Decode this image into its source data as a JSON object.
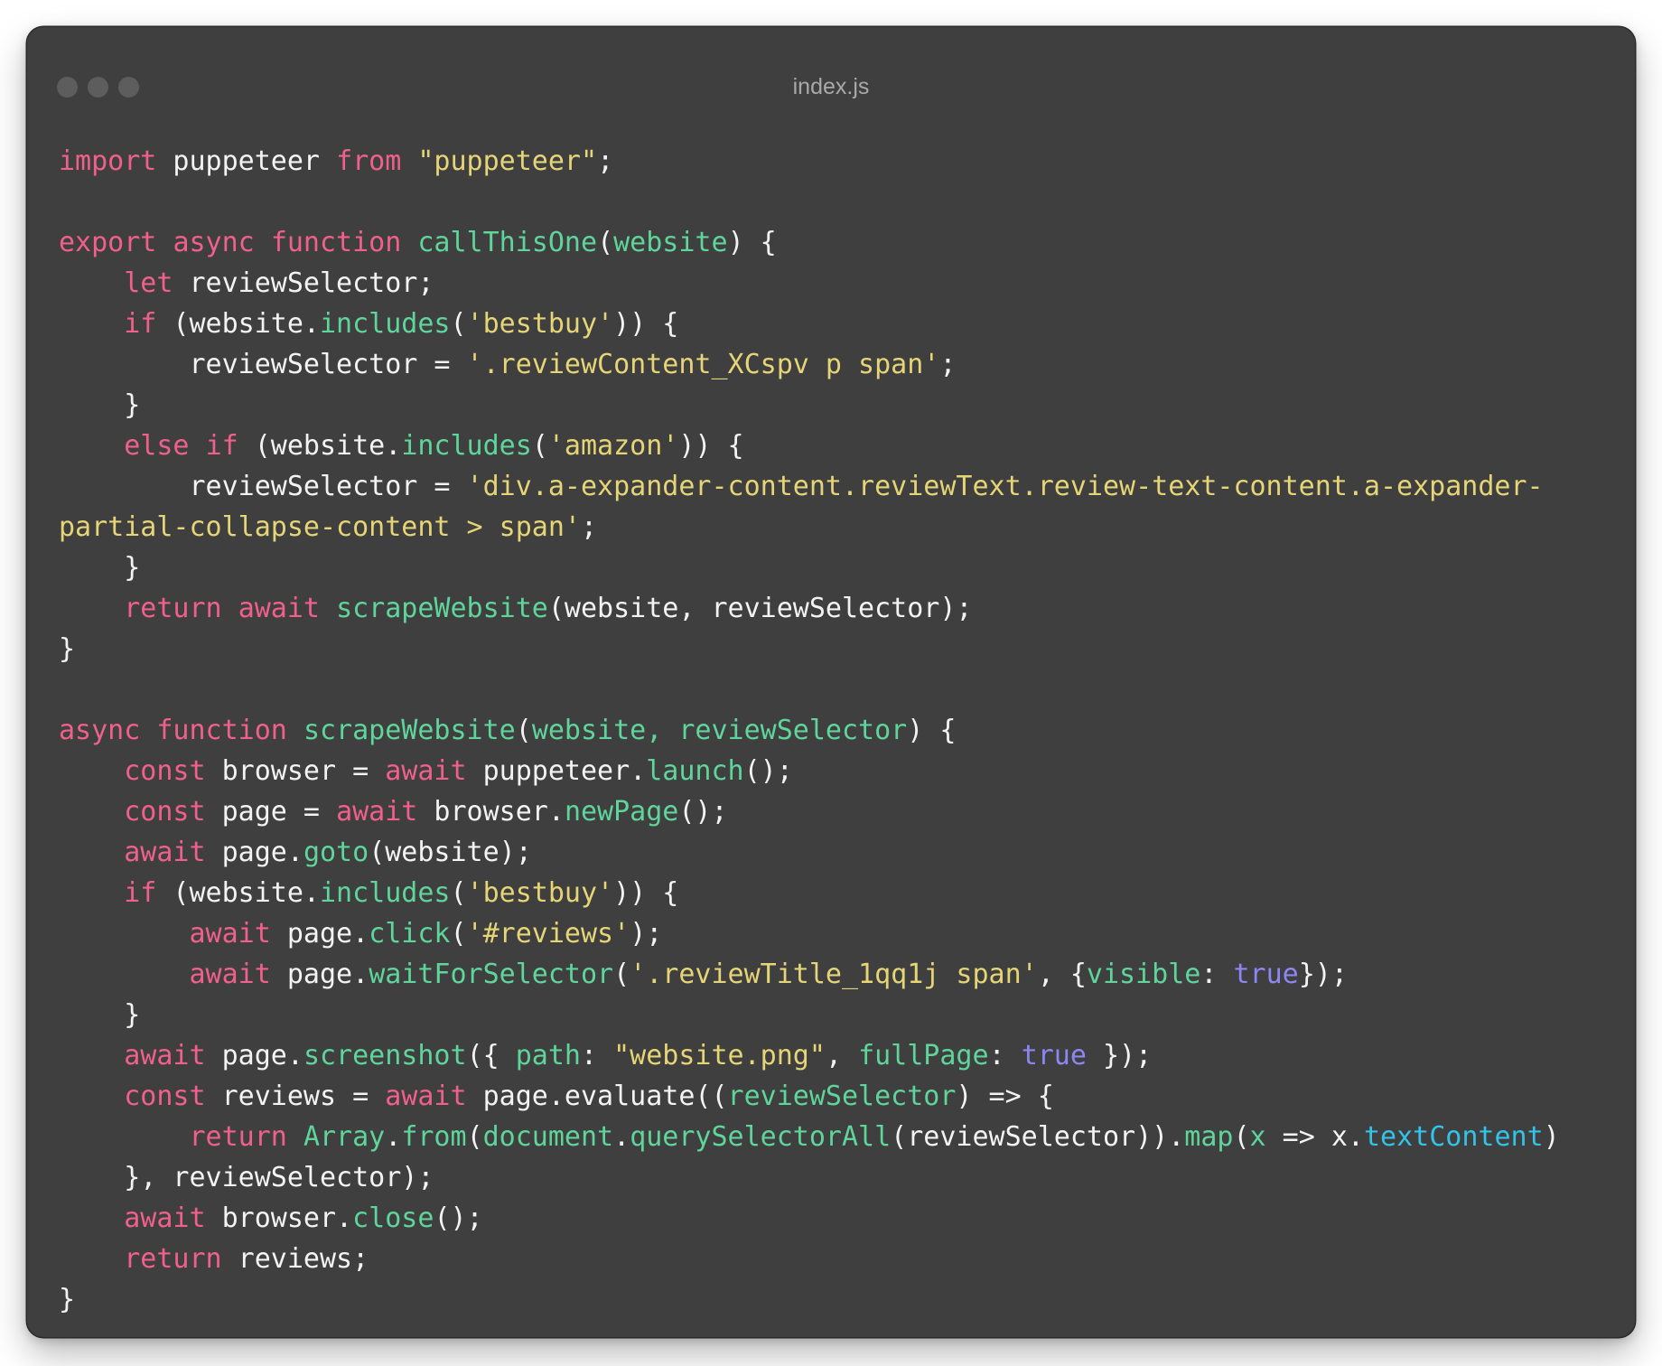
{
  "window": {
    "title": "index.js"
  },
  "colors": {
    "background": "#3f3f3f",
    "keyword": "#f0608c",
    "function": "#5fd59b",
    "string": "#e6d577",
    "boolean": "#8c87f2",
    "property": "#33c3e8",
    "text": "#f3f3f3"
  },
  "code_lines": [
    [
      [
        "kw",
        "import"
      ],
      [
        "plain",
        " puppeteer "
      ],
      [
        "kw",
        "from"
      ],
      [
        "plain",
        " "
      ],
      [
        "str",
        "\"puppeteer\""
      ],
      [
        "plain",
        ";"
      ]
    ],
    [],
    [
      [
        "kw",
        "export"
      ],
      [
        "plain",
        " "
      ],
      [
        "kw",
        "async"
      ],
      [
        "plain",
        " "
      ],
      [
        "kw",
        "function"
      ],
      [
        "plain",
        " "
      ],
      [
        "fn",
        "callThisOne"
      ],
      [
        "plain",
        "("
      ],
      [
        "pr",
        "website"
      ],
      [
        "plain",
        ") {"
      ]
    ],
    [
      [
        "plain",
        "    "
      ],
      [
        "kw",
        "let"
      ],
      [
        "plain",
        " reviewSelector;"
      ]
    ],
    [
      [
        "plain",
        "    "
      ],
      [
        "kw",
        "if"
      ],
      [
        "plain",
        " (website."
      ],
      [
        "fn",
        "includes"
      ],
      [
        "plain",
        "("
      ],
      [
        "str",
        "'bestbuy'"
      ],
      [
        "plain",
        ")) {"
      ]
    ],
    [
      [
        "plain",
        "        reviewSelector = "
      ],
      [
        "str",
        "'.reviewContent_XCspv p span'"
      ],
      [
        "plain",
        ";"
      ]
    ],
    [
      [
        "plain",
        "    }"
      ]
    ],
    [
      [
        "plain",
        "    "
      ],
      [
        "kw",
        "else"
      ],
      [
        "plain",
        " "
      ],
      [
        "kw",
        "if"
      ],
      [
        "plain",
        " (website."
      ],
      [
        "fn",
        "includes"
      ],
      [
        "plain",
        "("
      ],
      [
        "str",
        "'amazon'"
      ],
      [
        "plain",
        ")) {"
      ]
    ],
    [
      [
        "plain",
        "        reviewSelector = "
      ],
      [
        "str",
        "'div.a-expander-content.reviewText.review-text-content.a-expander-"
      ]
    ],
    [
      [
        "str",
        "partial-collapse-content > span'"
      ],
      [
        "plain",
        ";"
      ]
    ],
    [
      [
        "plain",
        "    }"
      ]
    ],
    [
      [
        "plain",
        "    "
      ],
      [
        "kw",
        "return"
      ],
      [
        "plain",
        " "
      ],
      [
        "kw",
        "await"
      ],
      [
        "plain",
        " "
      ],
      [
        "fn",
        "scrapeWebsite"
      ],
      [
        "plain",
        "(website, reviewSelector);"
      ]
    ],
    [
      [
        "plain",
        "}"
      ]
    ],
    [],
    [
      [
        "kw",
        "async"
      ],
      [
        "plain",
        " "
      ],
      [
        "kw",
        "function"
      ],
      [
        "plain",
        " "
      ],
      [
        "fn",
        "scrapeWebsite"
      ],
      [
        "plain",
        "("
      ],
      [
        "pr",
        "website, reviewSelector"
      ],
      [
        "plain",
        ") {"
      ]
    ],
    [
      [
        "plain",
        "    "
      ],
      [
        "kw",
        "const"
      ],
      [
        "plain",
        " browser = "
      ],
      [
        "kw",
        "await"
      ],
      [
        "plain",
        " puppeteer."
      ],
      [
        "fn",
        "launch"
      ],
      [
        "plain",
        "();"
      ]
    ],
    [
      [
        "plain",
        "    "
      ],
      [
        "kw",
        "const"
      ],
      [
        "plain",
        " page = "
      ],
      [
        "kw",
        "await"
      ],
      [
        "plain",
        " browser."
      ],
      [
        "fn",
        "newPage"
      ],
      [
        "plain",
        "();"
      ]
    ],
    [
      [
        "plain",
        "    "
      ],
      [
        "kw",
        "await"
      ],
      [
        "plain",
        " page."
      ],
      [
        "fn",
        "goto"
      ],
      [
        "plain",
        "(website);"
      ]
    ],
    [
      [
        "plain",
        "    "
      ],
      [
        "kw",
        "if"
      ],
      [
        "plain",
        " (website."
      ],
      [
        "fn",
        "includes"
      ],
      [
        "plain",
        "("
      ],
      [
        "str",
        "'bestbuy'"
      ],
      [
        "plain",
        ")) {"
      ]
    ],
    [
      [
        "plain",
        "        "
      ],
      [
        "kw",
        "await"
      ],
      [
        "plain",
        " page."
      ],
      [
        "fn",
        "click"
      ],
      [
        "plain",
        "("
      ],
      [
        "str",
        "'#reviews'"
      ],
      [
        "plain",
        ");"
      ]
    ],
    [
      [
        "plain",
        "        "
      ],
      [
        "kw",
        "await"
      ],
      [
        "plain",
        " page."
      ],
      [
        "fn",
        "waitForSelector"
      ],
      [
        "plain",
        "("
      ],
      [
        "str",
        "'.reviewTitle_1qq1j span'"
      ],
      [
        "plain",
        ", {"
      ],
      [
        "pr",
        "visible"
      ],
      [
        "plain",
        ": "
      ],
      [
        "bool",
        "true"
      ],
      [
        "plain",
        "});"
      ]
    ],
    [
      [
        "plain",
        "    }"
      ]
    ],
    [
      [
        "plain",
        "    "
      ],
      [
        "kw",
        "await"
      ],
      [
        "plain",
        " page."
      ],
      [
        "fn",
        "screenshot"
      ],
      [
        "plain",
        "({ "
      ],
      [
        "pr",
        "path"
      ],
      [
        "plain",
        ": "
      ],
      [
        "str",
        "\"website.png\""
      ],
      [
        "plain",
        ", "
      ],
      [
        "pr",
        "fullPage"
      ],
      [
        "plain",
        ": "
      ],
      [
        "bool",
        "true"
      ],
      [
        "plain",
        " });"
      ]
    ],
    [
      [
        "plain",
        "    "
      ],
      [
        "kw",
        "const"
      ],
      [
        "plain",
        " reviews = "
      ],
      [
        "kw",
        "await"
      ],
      [
        "plain",
        " page.evaluate(("
      ],
      [
        "pr",
        "reviewSelector"
      ],
      [
        "plain",
        ") => {"
      ]
    ],
    [
      [
        "plain",
        "        "
      ],
      [
        "kw",
        "return"
      ],
      [
        "plain",
        " "
      ],
      [
        "fn",
        "Array"
      ],
      [
        "plain",
        "."
      ],
      [
        "fn",
        "from"
      ],
      [
        "plain",
        "("
      ],
      [
        "fn",
        "document"
      ],
      [
        "plain",
        "."
      ],
      [
        "fn",
        "querySelectorAll"
      ],
      [
        "plain",
        "(reviewSelector))."
      ],
      [
        "fn",
        "map"
      ],
      [
        "plain",
        "("
      ],
      [
        "pr",
        "x"
      ],
      [
        "plain",
        " => x."
      ],
      [
        "prop2",
        "textContent"
      ],
      [
        "plain",
        ")"
      ]
    ],
    [
      [
        "plain",
        "    }, reviewSelector);"
      ]
    ],
    [
      [
        "plain",
        "    "
      ],
      [
        "kw",
        "await"
      ],
      [
        "plain",
        " browser."
      ],
      [
        "fn",
        "close"
      ],
      [
        "plain",
        "();"
      ]
    ],
    [
      [
        "plain",
        "    "
      ],
      [
        "kw",
        "return"
      ],
      [
        "plain",
        " reviews;"
      ]
    ],
    [
      [
        "plain",
        "}"
      ]
    ]
  ]
}
